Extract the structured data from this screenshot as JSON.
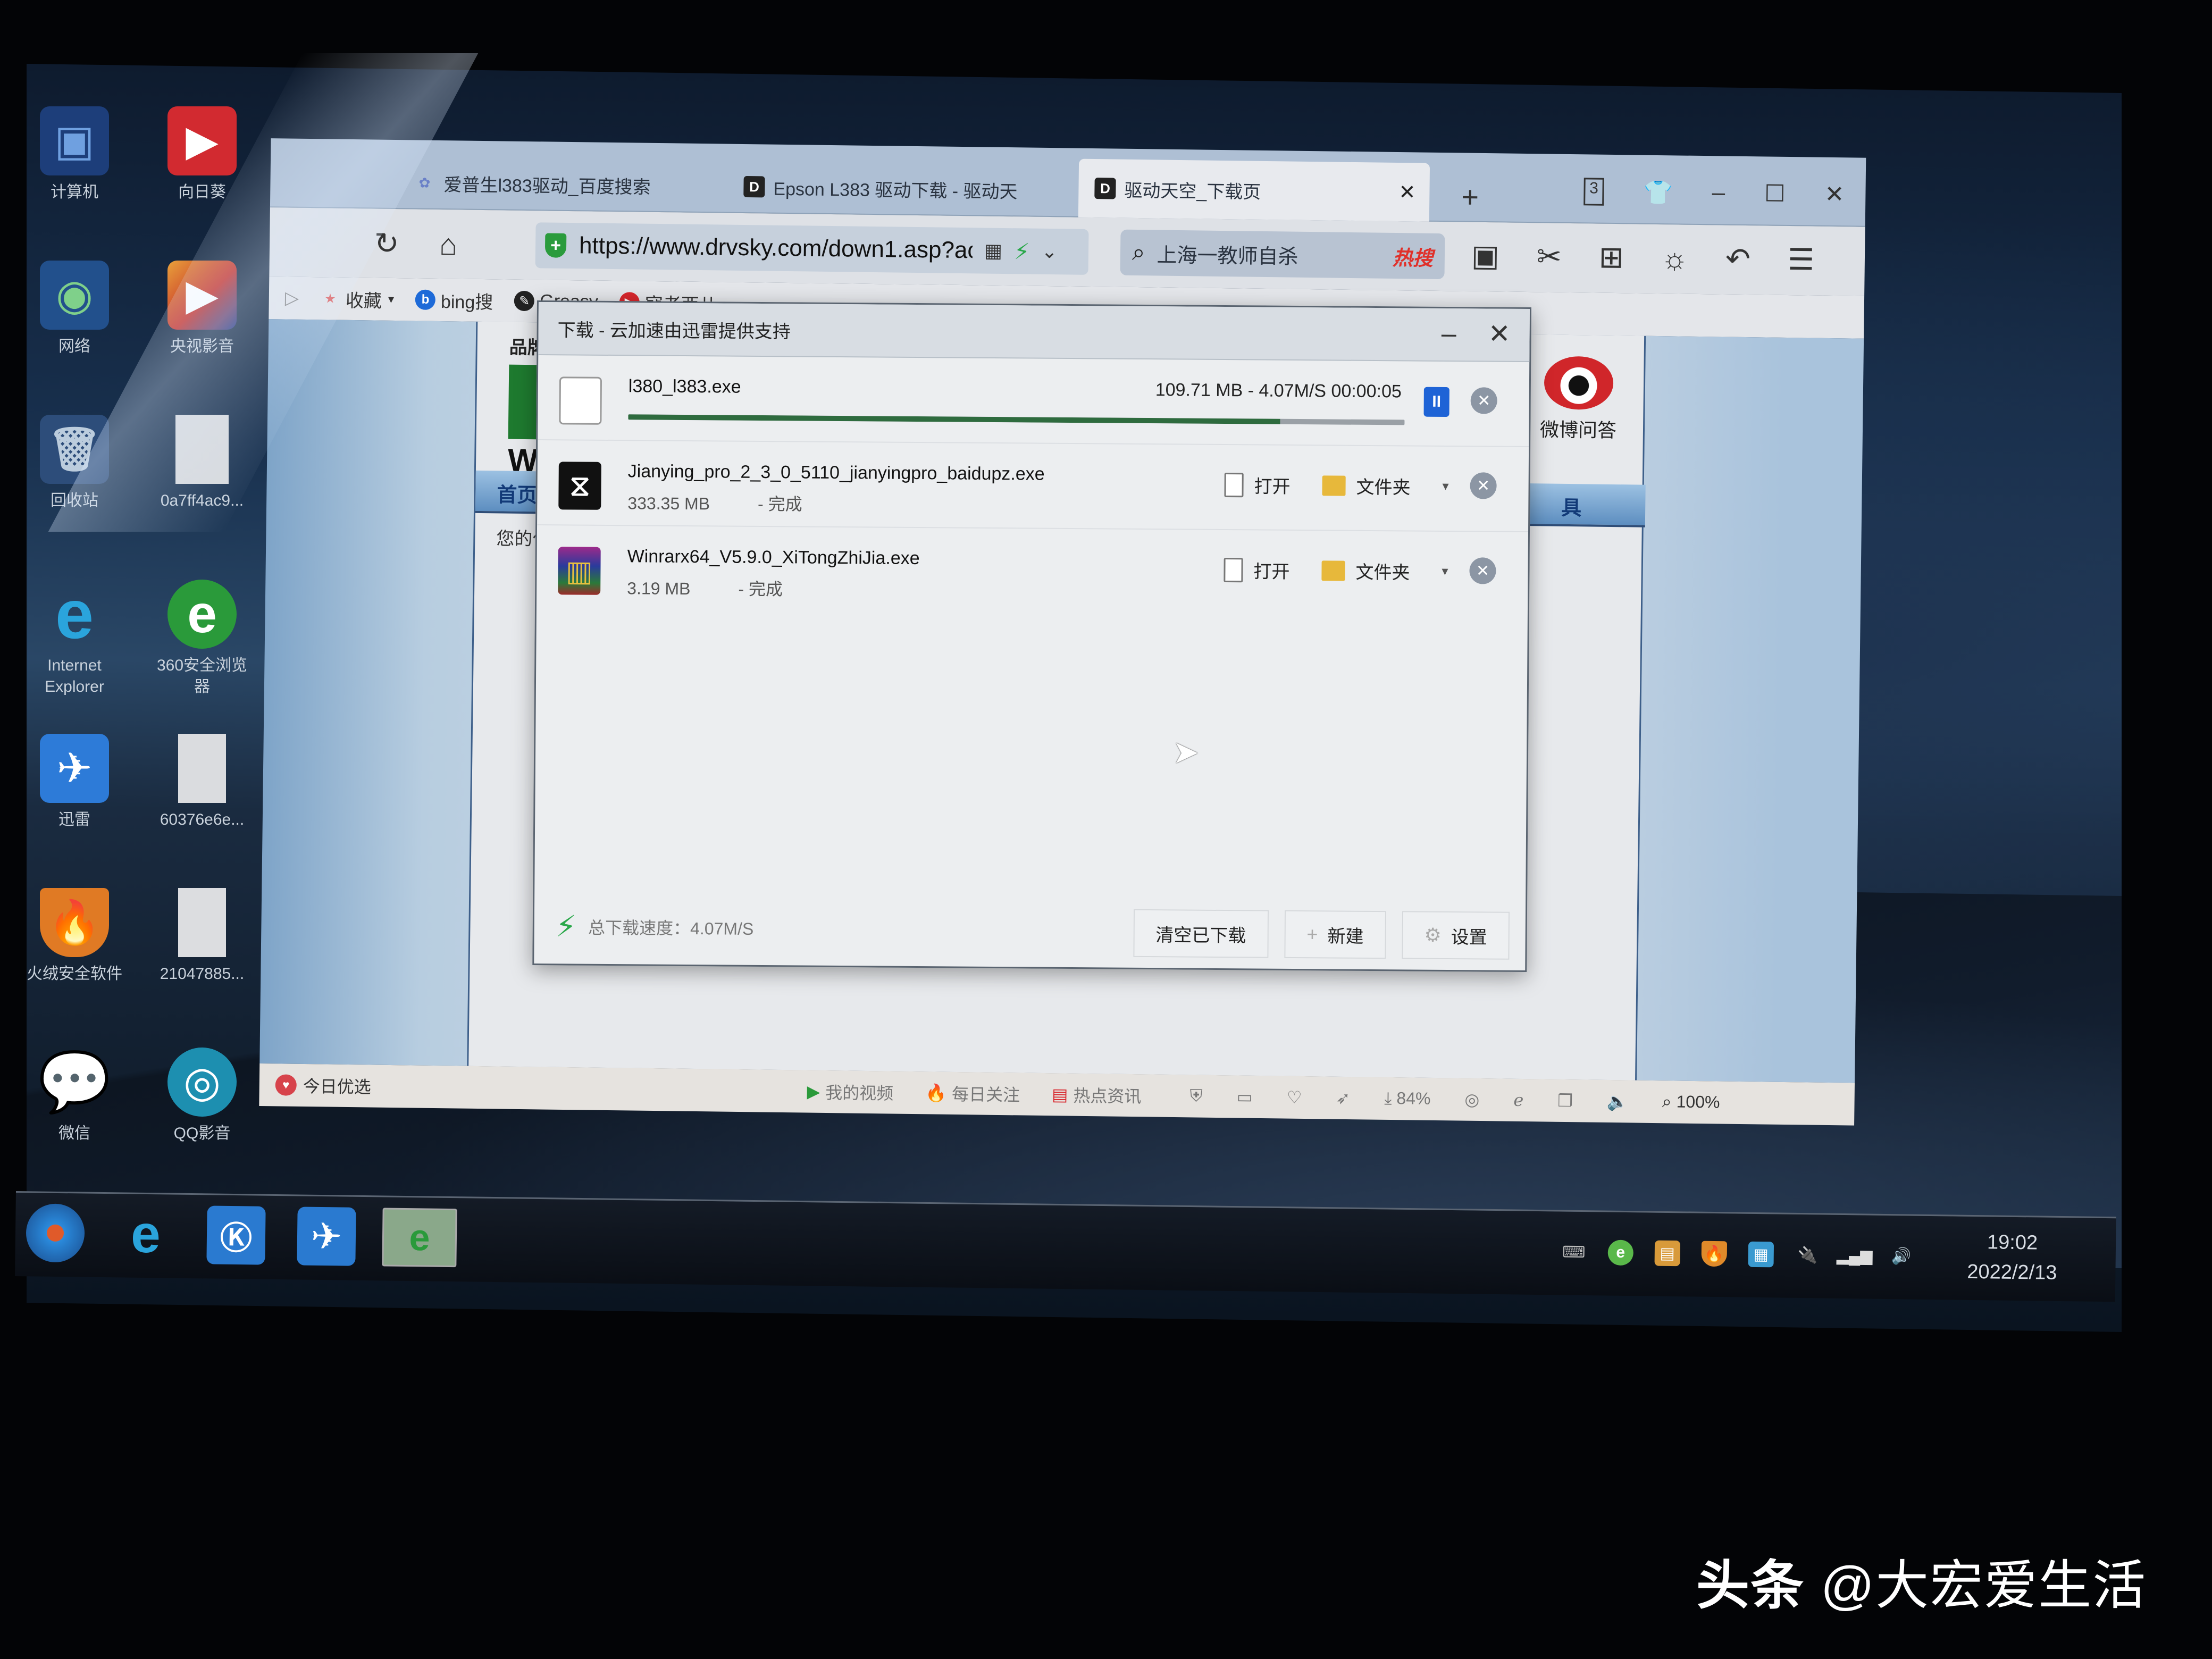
{
  "desktop": {
    "icons": [
      {
        "label": "计算机",
        "icon": "computer-icon"
      },
      {
        "label": "向日葵",
        "icon": "sunflower-icon"
      },
      {
        "label": "网络",
        "icon": "network-icon"
      },
      {
        "label": "央视影音",
        "icon": "cctv-video-icon"
      },
      {
        "label": "回收站",
        "icon": "recycle-bin-icon"
      },
      {
        "label": "0a7ff4ac9...",
        "icon": "image-file-icon"
      },
      {
        "label": "Internet Explorer",
        "icon": "ie-icon"
      },
      {
        "label": "360安全浏览器",
        "icon": "360-browser-icon"
      },
      {
        "label": "迅雷",
        "icon": "thunder-icon"
      },
      {
        "label": "60376e6e...",
        "icon": "image-file-icon"
      },
      {
        "label": "火绒安全软件",
        "icon": "huorong-icon"
      },
      {
        "label": "21047885...",
        "icon": "image-file-icon"
      },
      {
        "label": "微信",
        "icon": "wechat-icon"
      },
      {
        "label": "QQ影音",
        "icon": "qq-player-icon"
      }
    ]
  },
  "browser": {
    "tabs": [
      {
        "title": "爱普生l383驱动_百度搜索",
        "icon": "baidu-paw-icon",
        "active": false
      },
      {
        "title": "Epson L383 驱动下载 - 驱动天",
        "icon": "drvsky-icon",
        "active": false
      },
      {
        "title": "驱动天空_下载页",
        "icon": "drvsky-icon",
        "active": true
      }
    ],
    "new_tab": "+",
    "tab_count": "3",
    "window_controls": {
      "skin": "👕",
      "minimize": "–",
      "maximize": "☐",
      "close": "✕"
    },
    "address": {
      "url": "https://www.drvsky.com/down1.asp?ac"
    },
    "search": {
      "query": "上海一教师自杀",
      "hot_label": "热搜"
    },
    "bookmarks": [
      {
        "label": "收藏",
        "icon": "star-icon"
      },
      {
        "label": "bing搜",
        "icon": "bing-icon"
      },
      {
        "label": "Greasy",
        "icon": "greasyfork-icon"
      },
      {
        "label": "寇老西儿",
        "icon": "video-play-icon"
      }
    ],
    "page": {
      "brand_text": "品牌",
      "logo_text": "WW",
      "nav_home": "首页",
      "nav_right": "具",
      "breadcrumb": "您的位",
      "weibo_label": "微博问答"
    },
    "status_bar": {
      "left_label": "今日优选",
      "items": [
        {
          "label": "我的视频",
          "icon": "video-icon"
        },
        {
          "label": "每日关注",
          "icon": "flame-icon"
        },
        {
          "label": "热点资讯",
          "icon": "news-icon"
        }
      ],
      "download_percent": "84%",
      "zoom": "100%"
    }
  },
  "download_dialog": {
    "title": "下载 - 云加速由迅雷提供支持",
    "items": [
      {
        "filename": "l380_l383.exe",
        "progress_text": "109.71 MB - 4.07M/S 00:00:05",
        "progress": 0.84,
        "state": "downloading"
      },
      {
        "filename": "Jianying_pro_2_3_0_5110_jianyingpro_baidupz.exe",
        "size": "333.35 MB",
        "state": "- 完成",
        "open_label": "打开",
        "folder_label": "文件夹"
      },
      {
        "filename": "Winrarx64_V5.9.0_XiTongZhiJia.exe",
        "size": "3.19 MB",
        "state": "- 完成",
        "open_label": "打开",
        "folder_label": "文件夹"
      }
    ],
    "footer": {
      "total_speed": "总下载速度：4.07M/S",
      "clear_button": "清空已下载",
      "new_button": "新建",
      "settings_button": "设置"
    }
  },
  "taskbar": {
    "apps": [
      "start-icon",
      "ie-icon",
      "kugou-icon",
      "thunder-icon",
      "360-browser-icon"
    ],
    "clock": {
      "time": "19:02",
      "date": "2022/2/13"
    }
  },
  "watermark": {
    "prefix": "头条",
    "handle": "@大宏爱生活"
  }
}
